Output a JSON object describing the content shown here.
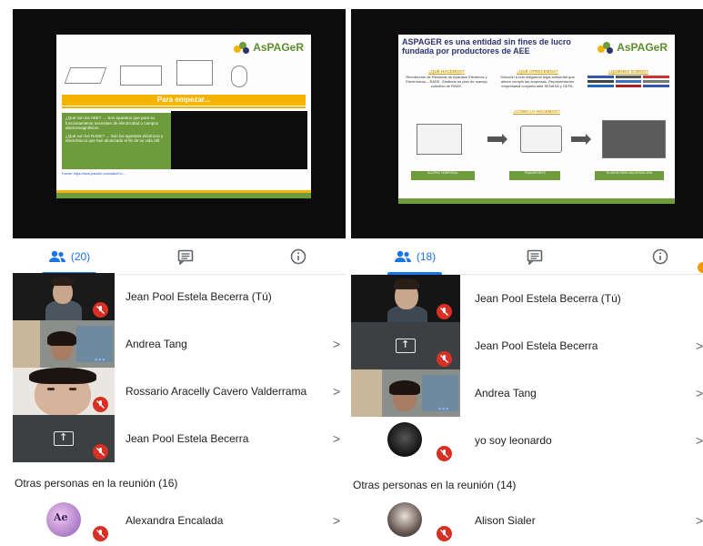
{
  "left": {
    "slide": {
      "logo": "AsPAGeR",
      "banner": "Para empezar...",
      "q1": "¿Qué son los AEE? → Son aparatos que para su funcionamiento necesitan de electricidad o campos electromagnéticos.",
      "q2": "¿Qué son los RAEE? → Son los aparatos eléctricos y electrónicos que han alcanzado el fin de su vida útil.",
      "source": "Fuente: https://www.youtube.com/watch?v=..."
    },
    "tabs": {
      "people_count": "(20)"
    },
    "participants": [
      {
        "name": "Jean Pool Estela Becerra (Tú)"
      },
      {
        "name": "Andrea Tang"
      },
      {
        "name": "Rossario Aracelly Cavero Valderrama"
      },
      {
        "name": "Jean Pool Estela Becerra"
      }
    ],
    "section": "Otras personas en la reunión (16)",
    "others": [
      {
        "name": "Alexandra Encalada"
      }
    ]
  },
  "right": {
    "slide": {
      "title": "ASPAGER es una entidad sin fines de lucro fundada por productores de AEE",
      "logo": "AsPAGeR",
      "col1_head": "¿QUÉ HACEMOS?",
      "col1": "Recolección de Residuos de Aparatos Eléctricos y Electrónicos – RAEE. Gestiona un plan de manejo colectivo de RAEE.",
      "col2_head": "¿QUÉ OFRECEMOS?",
      "col2": "Solución a una obligación legal ambiental que deben cumplir las empresas. Representación empresarial conjunta ante SENASA y OEFA.",
      "col3_head": "¿QUIÉNES SOMOS?",
      "how": "¿CÓMO LO HACEMOS?",
      "g1": "ACOPIO TEMPORAL",
      "g2": "TRANSPORTE",
      "g3": "PLANTA PARA VALORIZACIÓN"
    },
    "tabs": {
      "people_count": "(18)"
    },
    "participants": [
      {
        "name": "Jean Pool Estela Becerra (Tú)"
      },
      {
        "name": "Jean Pool Estela Becerra"
      },
      {
        "name": "Andrea Tang"
      },
      {
        "name": "yo soy leonardo"
      }
    ],
    "section": "Otras personas en la reunión (14)",
    "others": [
      {
        "name": "Alison Sialer"
      }
    ]
  },
  "chevron": ">",
  "icons": [
    "people-icon",
    "chat-icon",
    "info-icon",
    "mic-off-icon",
    "present-screen-icon",
    "more-dots-icon"
  ],
  "colors": {
    "accent": "#1a73e8",
    "mute": "#d93025",
    "brand_green": "#6e9b3b",
    "brand_yellow": "#f5b400"
  }
}
